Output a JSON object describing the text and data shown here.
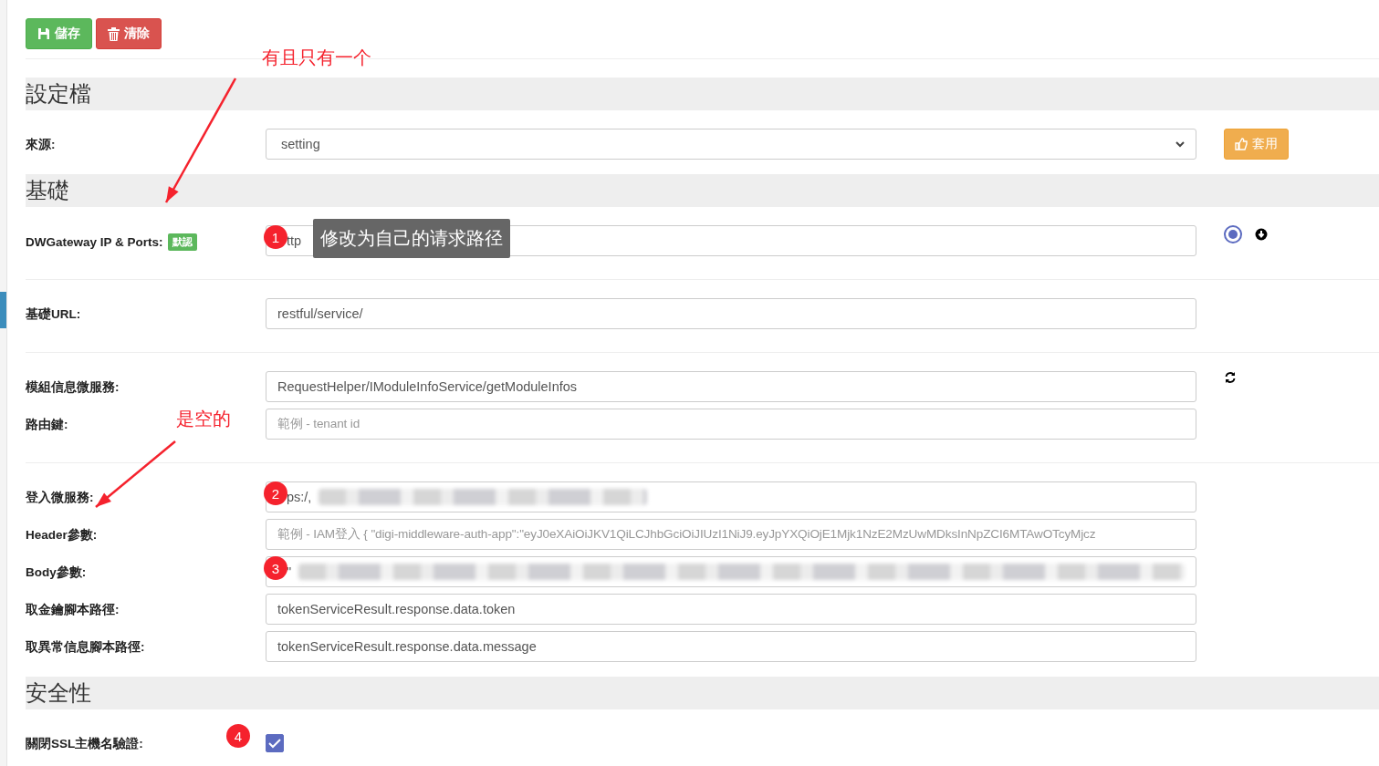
{
  "toolbar": {
    "buttons": [
      {
        "kind": "save",
        "label": "儲存"
      },
      {
        "kind": "clear",
        "label": "清除"
      }
    ]
  },
  "sections": [
    {
      "title": "設定檔",
      "groups": [
        [
          {
            "label": "來源:",
            "field": {
              "kind": "select",
              "value": "setting"
            },
            "actions": [
              {
                "kind": "apply",
                "label": "套用"
              }
            ]
          }
        ]
      ]
    },
    {
      "title": "基礎",
      "groups": [
        [
          {
            "label": "DWGateway IP & Ports:",
            "tag": "默認",
            "field": {
              "kind": "text",
              "value": "ttp",
              "badge": "1",
              "tooltip": "修改为自己的请求路径"
            },
            "actions": [
              {
                "kind": "radio",
                "selected": true
              },
              {
                "kind": "download"
              }
            ]
          }
        ],
        [
          {
            "label": "基礎URL:",
            "field": {
              "kind": "text",
              "value": "restful/service/"
            }
          }
        ],
        [
          {
            "label": "模組信息微服務:",
            "field": {
              "kind": "text",
              "value": "RequestHelper/IModuleInfoService/getModuleInfos"
            },
            "actions": [
              {
                "kind": "refresh"
              }
            ]
          },
          {
            "label": "路由鍵:",
            "field": {
              "kind": "text",
              "placeholder": "範例 - tenant id"
            }
          }
        ],
        [
          {
            "label": "登入微服務:",
            "field": {
              "kind": "text",
              "value": "ps:/,",
              "badge": "2",
              "blurred": true
            }
          },
          {
            "label": "Header參數:",
            "field": {
              "kind": "text",
              "placeholder": "範例 - IAM登入 { \"digi-middleware-auth-app\":\"eyJ0eXAiOiJKV1QiLCJhbGciOiJIUzI1NiJ9.eyJpYXQiOjE1Mjk1NzE2MzUwMDksInNpZCI6MTAwOTcyMjcz"
            }
          },
          {
            "label": "Body參數:",
            "field": {
              "kind": "text",
              "value": "\"",
              "badge": "3",
              "blurred": true
            }
          },
          {
            "label": "取金鑰腳本路徑:",
            "field": {
              "kind": "text",
              "value": "tokenServiceResult.response.data.token"
            }
          },
          {
            "label": "取異常信息腳本路徑:",
            "field": {
              "kind": "text",
              "value": "tokenServiceResult.response.data.message"
            }
          }
        ]
      ]
    },
    {
      "title": "安全性",
      "groups": [
        [
          {
            "label": "關閉SSL主機名驗證:",
            "field": {
              "kind": "checkbox",
              "checked": true,
              "badge": "4"
            }
          }
        ]
      ]
    }
  ],
  "annotations": [
    {
      "text": "有且只有一个"
    },
    {
      "text": "是空的"
    }
  ]
}
